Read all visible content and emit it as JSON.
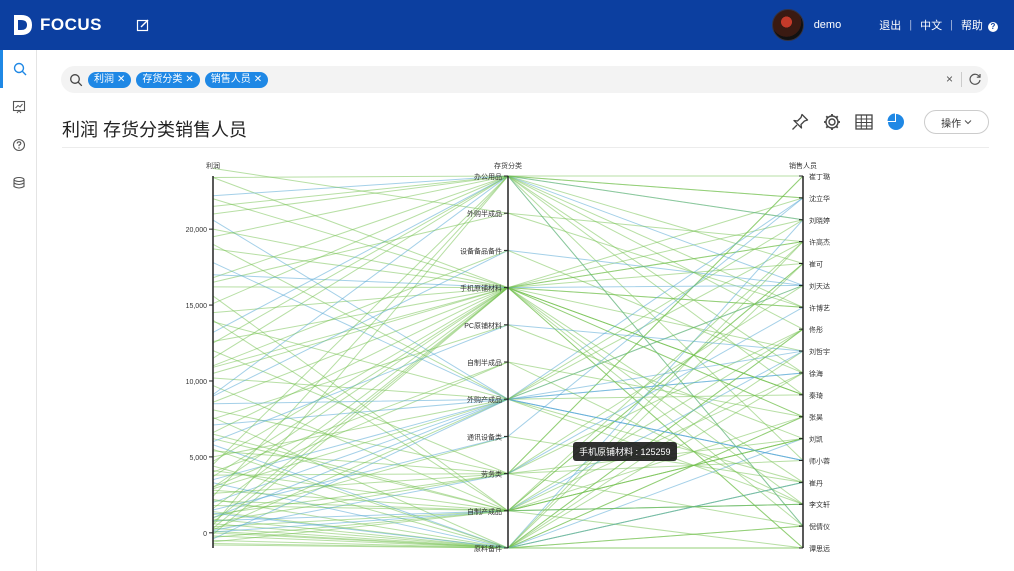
{
  "app": {
    "logo_text": "FOCUS"
  },
  "header": {
    "username": "demo",
    "logout": "退出",
    "language": "中文",
    "help": "帮助"
  },
  "search": {
    "chips": [
      "利润",
      "存货分类",
      "销售人员"
    ],
    "clear": "×"
  },
  "page": {
    "title": "利润 存货分类销售人员"
  },
  "toolbar": {
    "ops_label": "操作"
  },
  "tooltip": {
    "text": "手机原铺材料 : 125259"
  },
  "colors": {
    "brand": "#0c3fa0",
    "accent": "#1f88e5",
    "line_green": "#6fbf4a",
    "line_blue": "#5aaad6"
  },
  "chart_data": {
    "type": "parallel",
    "axes": [
      {
        "name": "利润",
        "kind": "value",
        "ticks": [
          "0",
          "5,000",
          "10,000",
          "15,000",
          "20,000"
        ],
        "tick_values": [
          0,
          5000,
          10000,
          15000,
          20000
        ],
        "range": [
          -1000,
          23500
        ]
      },
      {
        "name": "存货分类",
        "kind": "category",
        "categories": [
          "办公用品",
          "外购半成品",
          "设备备品备件",
          "手机原铺材料",
          "PC原铺材料",
          "自制半成品",
          "外购产成品",
          "通讯设备类",
          "劳务类",
          "自制产成品",
          "原料备件"
        ]
      },
      {
        "name": "销售人员",
        "kind": "category",
        "categories": [
          "崔丁璐",
          "沈立华",
          "刘晓婷",
          "许高杰",
          "崔可",
          "刘天达",
          "许博艺",
          "佟彤",
          "刘哲宇",
          "徐海",
          "秦琦",
          "张昊",
          "刘凯",
          "师小蓉",
          "崔丹",
          "李文轩",
          "倪倩仪",
          "谭思远"
        ]
      }
    ],
    "records": [
      [
        23400,
        0,
        0
      ],
      [
        23400,
        3,
        1
      ],
      [
        22200,
        0,
        2
      ],
      [
        22000,
        3,
        3
      ],
      [
        21500,
        0,
        4
      ],
      [
        20600,
        6,
        5
      ],
      [
        20000,
        3,
        6
      ],
      [
        19500,
        0,
        7
      ],
      [
        18700,
        3,
        8
      ],
      [
        17800,
        6,
        9
      ],
      [
        16800,
        0,
        10
      ],
      [
        16200,
        3,
        11
      ],
      [
        15600,
        9,
        12
      ],
      [
        15100,
        0,
        13
      ],
      [
        14500,
        3,
        14
      ],
      [
        13900,
        6,
        15
      ],
      [
        13200,
        0,
        16
      ],
      [
        12600,
        3,
        17
      ],
      [
        12000,
        8,
        0
      ],
      [
        11500,
        0,
        1
      ],
      [
        10900,
        3,
        2
      ],
      [
        10200,
        6,
        3
      ],
      [
        9700,
        9,
        4
      ],
      [
        9100,
        0,
        5
      ],
      [
        8600,
        3,
        6
      ],
      [
        8100,
        8,
        7
      ],
      [
        7600,
        10,
        8
      ],
      [
        7100,
        6,
        9
      ],
      [
        6600,
        3,
        10
      ],
      [
        6200,
        9,
        11
      ],
      [
        5800,
        10,
        12
      ],
      [
        5400,
        8,
        13
      ],
      [
        5000,
        6,
        14
      ],
      [
        4700,
        3,
        15
      ],
      [
        4400,
        10,
        16
      ],
      [
        4100,
        9,
        17
      ],
      [
        3800,
        8,
        0
      ],
      [
        3500,
        6,
        1
      ],
      [
        3300,
        10,
        2
      ],
      [
        3000,
        3,
        3
      ],
      [
        2800,
        9,
        4
      ],
      [
        2600,
        8,
        5
      ],
      [
        2400,
        0,
        6
      ],
      [
        2200,
        10,
        7
      ],
      [
        2000,
        6,
        8
      ],
      [
        1800,
        9,
        9
      ],
      [
        1600,
        3,
        10
      ],
      [
        1400,
        10,
        11
      ],
      [
        1200,
        8,
        12
      ],
      [
        1000,
        6,
        13
      ],
      [
        900,
        10,
        14
      ],
      [
        800,
        9,
        15
      ],
      [
        700,
        3,
        16
      ],
      [
        600,
        10,
        17
      ],
      [
        500,
        0,
        2
      ],
      [
        400,
        9,
        3
      ],
      [
        300,
        10,
        4
      ],
      [
        200,
        6,
        5
      ],
      [
        150,
        8,
        6
      ],
      [
        100,
        10,
        7
      ],
      [
        50,
        9,
        8
      ],
      [
        0,
        10,
        9
      ],
      [
        -100,
        3,
        10
      ],
      [
        -200,
        10,
        11
      ],
      [
        -300,
        9,
        12
      ],
      [
        -400,
        6,
        13
      ],
      [
        -500,
        10,
        14
      ],
      [
        -600,
        9,
        15
      ],
      [
        -700,
        10,
        16
      ],
      [
        -800,
        10,
        17
      ],
      [
        24000,
        1,
        3
      ],
      [
        9000,
        2,
        5
      ],
      [
        6000,
        4,
        8
      ],
      [
        3000,
        5,
        11
      ],
      [
        1000,
        7,
        14
      ],
      [
        16500,
        1,
        6
      ],
      [
        11000,
        2,
        9
      ],
      [
        7500,
        4,
        12
      ],
      [
        4000,
        5,
        15
      ],
      [
        1500,
        7,
        1
      ],
      [
        21000,
        0,
        16
      ],
      [
        19000,
        6,
        2
      ],
      [
        17000,
        3,
        5
      ],
      [
        14000,
        9,
        7
      ],
      [
        12500,
        0,
        9
      ],
      [
        10500,
        3,
        11
      ],
      [
        8500,
        6,
        13
      ],
      [
        6500,
        9,
        15
      ],
      [
        5500,
        10,
        3
      ],
      [
        4500,
        0,
        1
      ],
      [
        3700,
        3,
        4
      ],
      [
        2900,
        6,
        10
      ],
      [
        2100,
        9,
        12
      ],
      [
        1300,
        10,
        14
      ],
      [
        700,
        8,
        16
      ],
      [
        300,
        3,
        17
      ]
    ]
  }
}
